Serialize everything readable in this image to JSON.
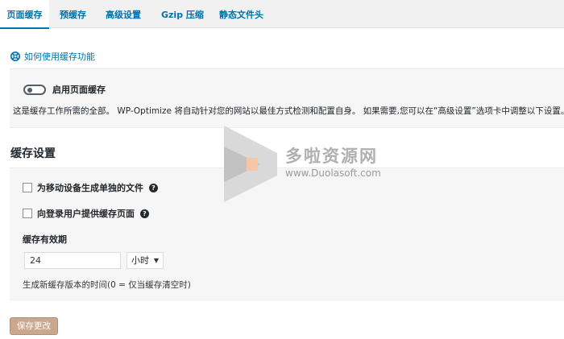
{
  "tabs": [
    {
      "label": "页面缓存",
      "active": true
    },
    {
      "label": "预缓存",
      "active": false
    },
    {
      "label": "高级设置",
      "active": false
    },
    {
      "label": "Gzip 压缩",
      "active": false
    },
    {
      "label": "静态文件头",
      "active": false
    }
  ],
  "help_link": {
    "label": "如何使用缓存功能",
    "icon": "lifebuoy-icon"
  },
  "enable_panel": {
    "toggle_on": false,
    "label": "启用页面缓存",
    "description": "这是缓存工作所需的全部。 WP-Optimize 将自动针对您的网站以最佳方式检测和配置自身。 如果需要,您可以在“高级设置”选项卡中调整以下设置。"
  },
  "settings": {
    "title": "缓存设置",
    "mobile_label": "为移动设备生成单独的文件",
    "mobile_checked": false,
    "loggedin_label": "向登录用户提供缓存页面",
    "loggedin_checked": false,
    "help_mark": "?",
    "lifespan_label": "缓存有效期",
    "lifespan_value": "24",
    "lifespan_unit": "小时",
    "lifespan_desc": "生成新缓存版本的时间(0 = 仅当缓存清空时)"
  },
  "save_button": "保存更改",
  "watermark": {
    "text": "多啦资源网",
    "url": "www.Duolasoft.com"
  },
  "colors": {
    "accent": "#0073aa",
    "save_button": "#c9a88f",
    "panel": "#f6f6f6"
  }
}
